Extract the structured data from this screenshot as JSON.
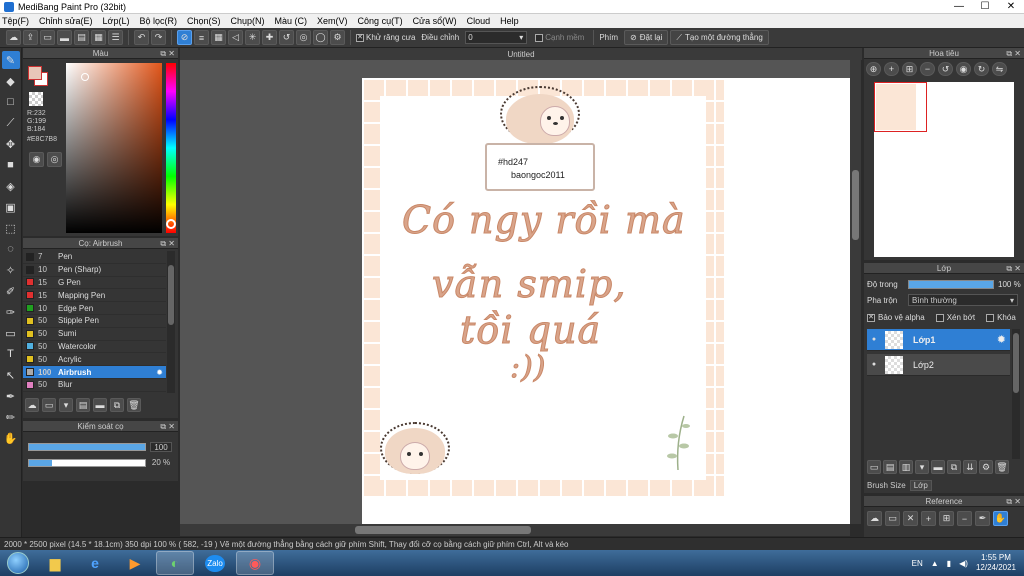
{
  "window": {
    "title": "MediBang Paint Pro (32bit)",
    "minimize": "—",
    "maximize": "☐",
    "close": "✕"
  },
  "menu": [
    "Tệp(F)",
    "Chỉnh sửa(E)",
    "Lớp(L)",
    "Bộ lọc(R)",
    "Chọn(S)",
    "Chụp(N)",
    "Màu (C)",
    "Xem(V)",
    "Công cụ(T)",
    "Cửa sổ(W)",
    "Cloud",
    "Help"
  ],
  "toolbar": {
    "antialias_label": "Khử răng cưa",
    "correction_label": "Điều chỉnh",
    "correction_value": "0",
    "edge_label": "Cạnh mềm",
    "key_label": "Phím",
    "reset_label": "Đặt lại",
    "line_label": "Tạo một đường thẳng"
  },
  "color_panel": {
    "title": "Màu",
    "r": "R:232",
    "g": "G:199",
    "b": "B:184",
    "hex": "#E8C7B8",
    "current_color": "#e8c7b8"
  },
  "brush_panel": {
    "title": "Cọ: Airbrush",
    "items": [
      {
        "size": "7",
        "name": "Pen",
        "color": "#222222"
      },
      {
        "size": "10",
        "name": "Pen (Sharp)",
        "color": "#222222"
      },
      {
        "size": "15",
        "name": "G Pen",
        "color": "#e03030"
      },
      {
        "size": "15",
        "name": "Mapping Pen",
        "color": "#e03030"
      },
      {
        "size": "10",
        "name": "Edge Pen",
        "color": "#20a020"
      },
      {
        "size": "50",
        "name": "Stipple Pen",
        "color": "#e0c020"
      },
      {
        "size": "50",
        "name": "Sumi",
        "color": "#e0c020"
      },
      {
        "size": "50",
        "name": "Watercolor",
        "color": "#50b0e0"
      },
      {
        "size": "50",
        "name": "Acrylic",
        "color": "#e0c020"
      },
      {
        "size": "100",
        "name": "Airbrush",
        "color": "#aaaaaa",
        "active": true
      },
      {
        "size": "50",
        "name": "Blur",
        "color": "#e080c0"
      }
    ]
  },
  "brush_control": {
    "title": "Kiểm soát cọ",
    "size_value": "100",
    "size_fraction": 1.0,
    "opacity_value": "20 %",
    "opacity_fraction": 0.2
  },
  "canvas": {
    "tab_title": "Untitled",
    "sign_line1": "#hd247",
    "sign_line2": "baongoc2011",
    "line1": "Có ngy rồi mà",
    "line2": "vẫn smip,",
    "line3": "tồi quá",
    "line4": ":))"
  },
  "navigator": {
    "title": "Hoa tiêu"
  },
  "layer_panel": {
    "title": "Lớp",
    "opacity_label": "Độ trong",
    "opacity_value": "100 %",
    "blend_label": "Pha trộn",
    "blend_value": "Bình thường",
    "protect_alpha": "Bảo vệ alpha",
    "clipping": "Xén bớt",
    "lock": "Khóa",
    "layers": [
      {
        "name": "Lớp1",
        "active": true
      },
      {
        "name": "Lớp2",
        "active": false
      }
    ],
    "tab_brush_size": "Brush Size",
    "tab_layer": "Lớp"
  },
  "reference_panel": {
    "title": "Reference"
  },
  "status": {
    "text": "2000 * 2500 pixel   (14.5 * 18.1cm)   350 dpi   100 %   ( 582, -19 )   Vẽ một đường thẳng bằng cách giữ phím Shift, Thay đổi cỡ cọ bằng cách giữ phím Ctrl, Alt và kéo"
  },
  "taskbar": {
    "lang": "EN",
    "time": "1:55 PM",
    "date": "12/24/2021",
    "zalo": "Zalo"
  }
}
